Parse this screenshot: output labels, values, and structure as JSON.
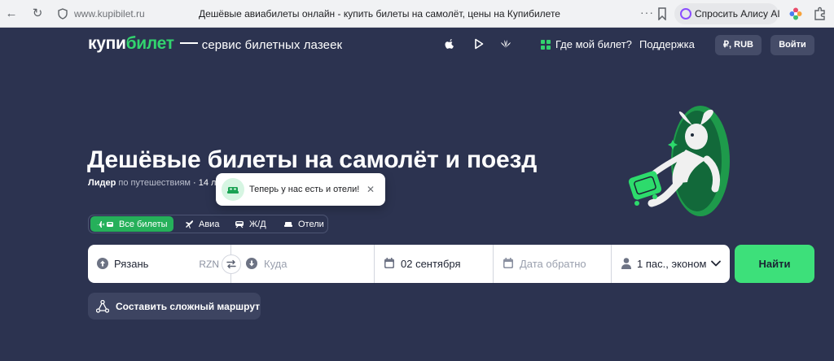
{
  "browser": {
    "url": "www.kupibilet.ru",
    "tab_title": "Дешёвые авиабилеты онлайн - купить билеты на самолёт, цены на Купибилете",
    "dots": "···",
    "alice_label": "Спросить Алису AI"
  },
  "header": {
    "logo_kupi": "купи",
    "logo_bilet": "билет",
    "slogan": "сервис билетных лазеек",
    "where_ticket": "Где мой билет?",
    "support": "Поддержка",
    "currency": "₽, RUB",
    "login": "Войти"
  },
  "hero": {
    "title": "Дешёвые билеты на самолёт и поезд",
    "leader": "Лидер",
    "subtitle_rest": "по путешествиям",
    "subtitle_extra": "· 14 ле"
  },
  "tooltip": {
    "text": "Теперь у нас есть и отели!",
    "close": "✕"
  },
  "tabs": [
    {
      "label": "Все билеты",
      "active": true
    },
    {
      "label": "Авиа",
      "active": false
    },
    {
      "label": "Ж/Д",
      "active": false
    },
    {
      "label": "Отели",
      "active": false
    }
  ],
  "search": {
    "from_value": "Рязань",
    "from_code": "RZN",
    "to_placeholder": "Куда",
    "date_value": "02 сентября",
    "return_placeholder": "Дата обратно",
    "passengers": "1 пас., эконом",
    "button": "Найти"
  },
  "route_button": "Составить сложный маршрут",
  "colors": {
    "background": "#2c3350",
    "accent_green": "#32d46e",
    "search_button": "#3de07a",
    "active_tab": "#25b05a"
  }
}
